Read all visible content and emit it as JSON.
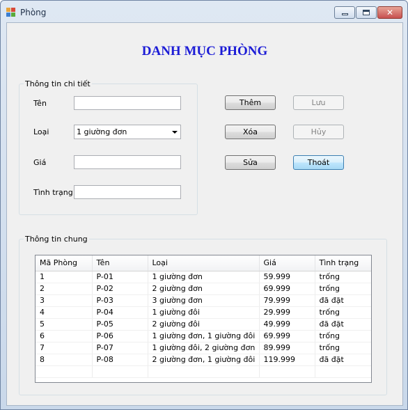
{
  "window": {
    "title": "Phòng",
    "icon": "app-window-icon"
  },
  "heading": "DANH MỤC PHÒNG",
  "details": {
    "legend": "Thông tin chi tiết",
    "name_label": "Tên",
    "name_value": "",
    "type_label": "Loại",
    "type_value": "1 giường đơn",
    "price_label": "Giá",
    "price_value": "",
    "status_label": "Tình trạng",
    "status_value": ""
  },
  "buttons": {
    "add": "Thêm",
    "delete": "Xóa",
    "edit": "Sửa",
    "save": "Lưu",
    "cancel": "Hủy",
    "exit": "Thoát"
  },
  "general": {
    "legend": "Thông tin chung",
    "columns": [
      "Mã Phòng",
      "Tên",
      "Loại",
      "Giá",
      "Tình trạng"
    ],
    "rows": [
      [
        "1",
        "P-01",
        "1 giường đơn",
        "59.999",
        "trống"
      ],
      [
        "2",
        "P-02",
        "2 giường đơn",
        "69.999",
        "trống"
      ],
      [
        "3",
        "P-03",
        "3 giường đơn",
        "79.999",
        "đã đặt"
      ],
      [
        "4",
        "P-04",
        "1 giường đôi",
        "29.999",
        "trống"
      ],
      [
        "5",
        "P-05",
        "2 giường đôi",
        "49.999",
        "đã đặt"
      ],
      [
        "6",
        "P-06",
        "1 giường đơn, 1 giường đôi",
        "69.999",
        "trống"
      ],
      [
        "7",
        "P-07",
        "1 giường đôi, 2 giường đơn",
        "89.999",
        "trống"
      ],
      [
        "8",
        "P-08",
        "2 giường đơn, 1 giường đôi",
        "119.999",
        "đã đặt"
      ]
    ]
  },
  "colors": {
    "heading": "#1c1cd6",
    "form_background": "#f0f0f0"
  }
}
